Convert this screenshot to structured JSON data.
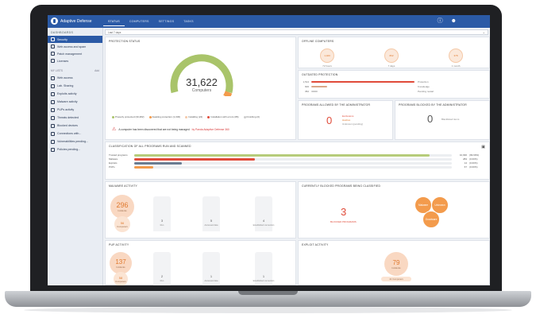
{
  "app": {
    "name": "Adaptive Defense"
  },
  "nav": {
    "tabs": [
      "STATUS",
      "COMPUTERS",
      "SETTINGS",
      "TASKS"
    ]
  },
  "sidebar": {
    "section_dashboards": "DASHBOARDS",
    "items_top": [
      "Security",
      "Web access and spam",
      "Patch management",
      "Licenses"
    ],
    "section_my_lists": "MY LISTS",
    "add_label": "Add",
    "items_lists": [
      "Web access",
      "Lab. Sharing",
      "Exploits activity",
      "Malware activity",
      "PUPs activity",
      "Threats detected",
      "Blocked devices",
      "Connections with...",
      "Vulnerabilities pending...",
      "Policies pending..."
    ]
  },
  "filter": {
    "value": "Last 7 days"
  },
  "protection_status": {
    "title": "PROTECTION STATUS",
    "count": "31,622",
    "unit": "Computers",
    "legend": [
      "Properly protected (30,482)",
      "Awaiting protection (1,030)",
      "Installing (24)",
      "Installation with errors (86)",
      "Finishing (0)"
    ],
    "alert_text": "A computer has been discovered that are not being managed",
    "alert_link": "by Panda Adaptive Defense 360"
  },
  "offline": {
    "title": "OFFLINE COMPUTERS",
    "items": [
      {
        "value": "1,020",
        "label": "72 hours"
      },
      {
        "value": "802",
        "label": "7 days"
      },
      {
        "value": "378",
        "label": "1 month"
      }
    ]
  },
  "outdated": {
    "title": "OUTDATED PROTECTION",
    "rows": [
      {
        "label": "1,514",
        "tag": "Protection",
        "color": "#e04b3a"
      },
      {
        "label": "600",
        "tag": "Knowledge",
        "color": "#d9a88a"
      },
      {
        "label": "352",
        "tag": "Pending restart",
        "color": "#cccccc"
      }
    ]
  },
  "allowed": {
    "title": "PROGRAMS ALLOWED BY THE ADMINISTRATOR",
    "value": "0",
    "lines": [
      "Exclusions",
      "Hashes",
      "Unknown (pending)"
    ]
  },
  "blocked": {
    "title": "PROGRAMS BLOCKED BY THE ADMINISTRATOR",
    "value": "0",
    "line": "Blacklisted items"
  },
  "classification": {
    "title": "CLASSIFICATION OF ALL PROGRAMS RUN AND SCANNED",
    "rows": [
      {
        "label": "Trusted programs",
        "value": "10,930",
        "extra": "(99.99%)",
        "fill": 0.93,
        "color": "#b6cc7a"
      },
      {
        "label": "Malware",
        "value": "284",
        "extra": "(0.00%)",
        "fill": 0.38,
        "color": "#e04b3a"
      },
      {
        "label": "Exploits",
        "value": "14",
        "extra": "(0.00%)",
        "fill": 0.15,
        "color": "#6a7d92"
      },
      {
        "label": "PUPs",
        "value": "67",
        "extra": "(0.00%)",
        "fill": 0.06,
        "color": "#f39b4c"
      }
    ]
  },
  "malware_activity": {
    "title": "MALWARE ACTIVITY",
    "total": "296",
    "total_sub": "Incidents",
    "small": "56",
    "small_sub": "Computers",
    "bars": [
      {
        "value": "3",
        "label": "Run"
      },
      {
        "value": "5",
        "label": "Accessed data"
      },
      {
        "value": "4",
        "label": "Established connection"
      }
    ]
  },
  "blocked_programs": {
    "title": "CURRENTLY BLOCKED PROGRAMS BEING CLASSIFIED",
    "value": "3",
    "label": "BLOCKED PROGRAMS",
    "bubbles": [
      "Malware",
      "Unknown",
      "Goodware"
    ]
  },
  "pup_activity": {
    "title": "PUP ACTIVITY",
    "total": "137",
    "total_sub": "Incidents",
    "small": "58",
    "small_sub": "Computers",
    "bars": [
      {
        "value": "2",
        "label": "Run"
      },
      {
        "value": "1",
        "label": "Accessed data"
      },
      {
        "value": "1",
        "label": "Established connection"
      }
    ]
  },
  "exploit_activity": {
    "title": "EXPLOIT ACTIVITY",
    "total": "79",
    "total_sub": "Incidents",
    "sub": "41 Computers"
  },
  "colors": {
    "accent": "#2b5aa6",
    "warn": "#e04b3a",
    "orange": "#f39b4c",
    "green": "#a9c46a"
  }
}
